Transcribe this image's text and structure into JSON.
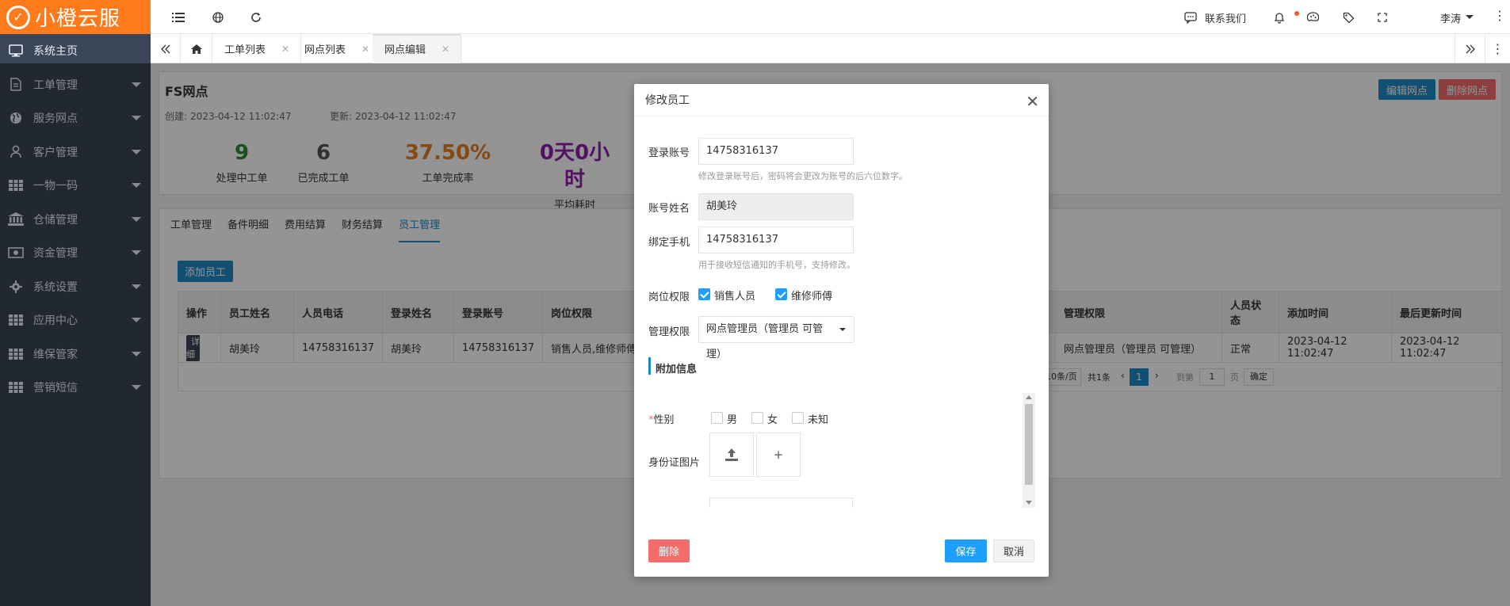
{
  "app": {
    "logo_text": "小橙云服"
  },
  "sidebar": {
    "items": [
      {
        "label": "系统主页",
        "icon": "monitor-icon",
        "caret": false
      },
      {
        "label": "工单管理",
        "icon": "document-icon",
        "caret": true
      },
      {
        "label": "服务网点",
        "icon": "globe-icon",
        "caret": true
      },
      {
        "label": "客户管理",
        "icon": "user-icon",
        "caret": true
      },
      {
        "label": "一物一码",
        "icon": "grid-icon",
        "caret": true
      },
      {
        "label": "仓储管理",
        "icon": "bank-icon",
        "caret": true
      },
      {
        "label": "资金管理",
        "icon": "money-icon",
        "caret": true
      },
      {
        "label": "系统设置",
        "icon": "gear-icon",
        "caret": true
      },
      {
        "label": "应用中心",
        "icon": "grid-icon",
        "caret": true
      },
      {
        "label": "维保管家",
        "icon": "grid-icon",
        "caret": true
      },
      {
        "label": "营销短信",
        "icon": "grid-icon",
        "caret": true
      }
    ]
  },
  "topbar": {
    "contact_label": "联系我们",
    "user_name": "李涛"
  },
  "tabs": [
    {
      "label": "工单列表"
    },
    {
      "label": "网点列表"
    },
    {
      "label": "网点编辑"
    }
  ],
  "site": {
    "name": "FS网点",
    "created_label": "创建:",
    "created_value": "2023-04-12 11:02:47",
    "updated_label": "更新:",
    "updated_value": "2023-04-12 11:02:47",
    "edit_button": "编辑网点",
    "delete_button": "删除网点"
  },
  "stats": [
    {
      "value": "9",
      "label": "处理中工单",
      "color": "#2e8b2e"
    },
    {
      "value": "6",
      "label": "已完成工单",
      "color": "#555555"
    },
    {
      "value": "37.50%",
      "label": "工单完成率",
      "color": "#e67e22"
    },
    {
      "value": "0天0小时",
      "label": "平均耗时",
      "color": "#8e1fa8"
    }
  ],
  "subtabs": [
    "工单管理",
    "备件明细",
    "费用结算",
    "财务结算",
    "员工管理"
  ],
  "employee": {
    "add_button": "添加员工",
    "columns": [
      "操作",
      "员工姓名",
      "人员电话",
      "登录姓名",
      "登录账号",
      "岗位权限",
      "管理权限",
      "人员状态",
      "添加时间",
      "最后更新时间"
    ],
    "rows": [
      {
        "action": "详细",
        "name": "胡美玲",
        "phone": "14758316137",
        "login_name": "胡美玲",
        "login_account": "14758316137",
        "roles": "销售人员,维修师傅",
        "admin": "网点管理员（管理员 可管理）",
        "status": "正常",
        "added": "2023-04-12 11:02:47",
        "updated": "2023-04-12 11:02:47"
      }
    ],
    "pager": {
      "page_size": "10条/页",
      "total": "共1条",
      "current": "1",
      "goto_label": "到第",
      "goto_value": "1",
      "page_suffix": "页",
      "confirm": "确定"
    }
  },
  "modal": {
    "title": "修改员工",
    "login_account_label": "登录账号",
    "login_account_value": "14758316137",
    "login_account_hint": "修改登录账号后，密码将会更改为账号的后六位数字。",
    "account_name_label": "账号姓名",
    "account_name_value": "胡美玲",
    "bind_phone_label": "绑定手机",
    "bind_phone_value": "14758316137",
    "bind_phone_hint": "用于接收短信通知的手机号，支持修改。",
    "role_label": "岗位权限",
    "role_options": [
      {
        "label": "销售人员",
        "checked": true
      },
      {
        "label": "维修师傅",
        "checked": true
      }
    ],
    "admin_label": "管理权限",
    "admin_value": "网点管理员（管理员 可管理）",
    "extra_section": "附加信息",
    "gender_label": "性别",
    "gender_options": [
      "男",
      "女",
      "未知"
    ],
    "id_photo_label": "身份证图片",
    "upload_plus": "+",
    "delete_button": "删除",
    "save_button": "保存",
    "cancel_button": "取消"
  },
  "colors": {
    "brand": "#ff7a1a",
    "sidebar_bg": "#3a4557",
    "primary_blue": "#1e88c7",
    "danger": "#f56c6c",
    "save_blue": "#1e9fff"
  }
}
